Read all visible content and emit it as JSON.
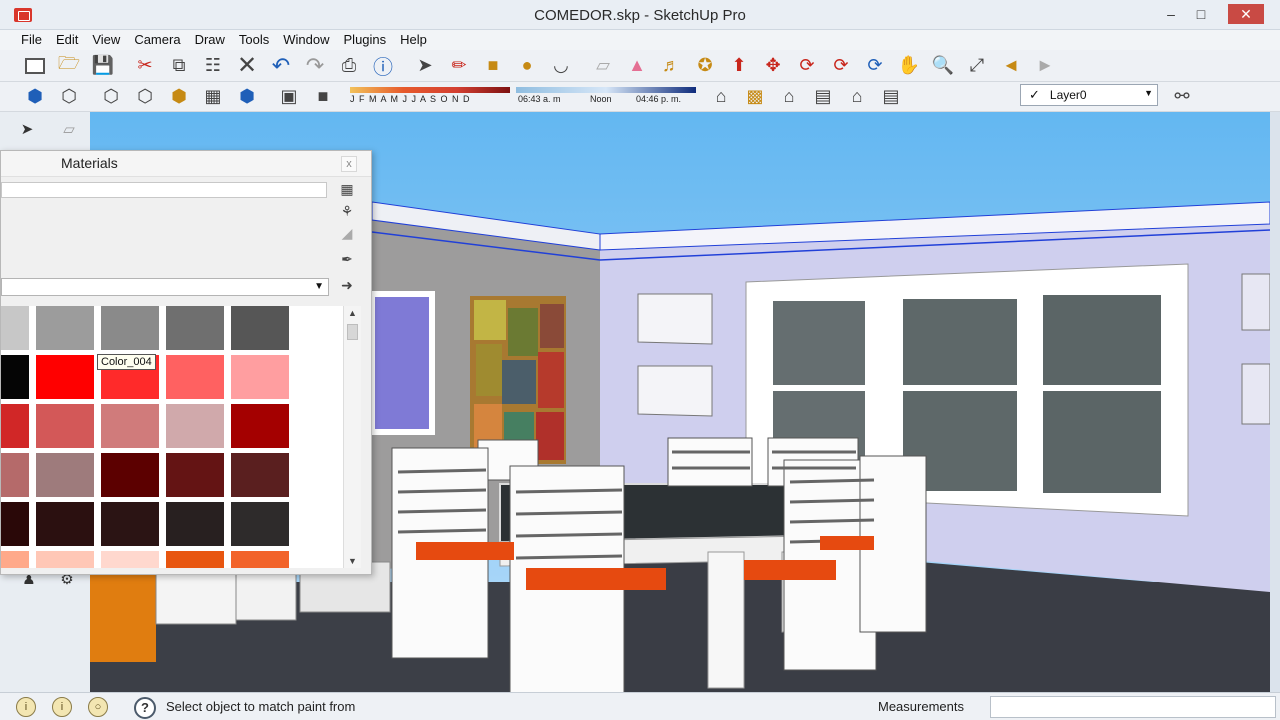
{
  "window": {
    "title": "COMEDOR.skp - SketchUp Pro",
    "minimize": "–",
    "maximize": "□",
    "close": "✕"
  },
  "menu": [
    "File",
    "Edit",
    "View",
    "Camera",
    "Draw",
    "Tools",
    "Window",
    "Plugins",
    "Help"
  ],
  "toolbar1_icons": [
    "new-icon",
    "open-icon",
    "save-icon",
    "cut-icon",
    "copy-icon",
    "paste-icon",
    "erase-icon",
    "undo-icon",
    "redo-icon",
    "print-icon",
    "model-info-icon",
    "select-icon",
    "pencil-icon",
    "rectangle-icon",
    "circle-icon",
    "arc-icon",
    "eraser-icon",
    "paint-bucket-icon",
    "tape-measure-icon",
    "push-pull-icon",
    "move-icon",
    "rotate-icon",
    "follow-me-icon",
    "orbit-icon",
    "pan-icon",
    "zoom-icon",
    "zoom-extents-icon",
    "previous-view-icon",
    "next-view-icon"
  ],
  "shadows": {
    "months": "J F M A M J J A S O N D",
    "time_start": "06:43 a. m",
    "time_noon": "Noon",
    "time_end": "04:46 p. m."
  },
  "layer": {
    "current": "Layer0"
  },
  "materials": {
    "title": "Materials",
    "tooltip": "Color_004",
    "close": "x",
    "swatches": [
      [
        "#c7c7c7",
        "#9c9c9c",
        "#8a8a8a",
        "#6f6f6f",
        "#565656"
      ],
      [
        "#050505",
        "#ff0000",
        "#ff2a2a",
        "#ff6161",
        "#ff9ea0"
      ],
      [
        "#d12727",
        "#d35858",
        "#d07b7b",
        "#d0a9ab",
        "#a40000"
      ],
      [
        "#b56a6a",
        "#9e7b7c",
        "#5c0000",
        "#641414",
        "#5a1f1f"
      ],
      [
        "#2a0808",
        "#2b1010",
        "#2b1414",
        "#282020",
        "#2e2b2b"
      ],
      [
        "#ffa98a",
        "#ffc7b6",
        "#ffd8ce",
        "#e85610",
        "#f2632a"
      ]
    ]
  },
  "status": {
    "text": "Select object to match paint from",
    "measurements_label": "Measurements",
    "measurements_value": "",
    "help": "?"
  }
}
